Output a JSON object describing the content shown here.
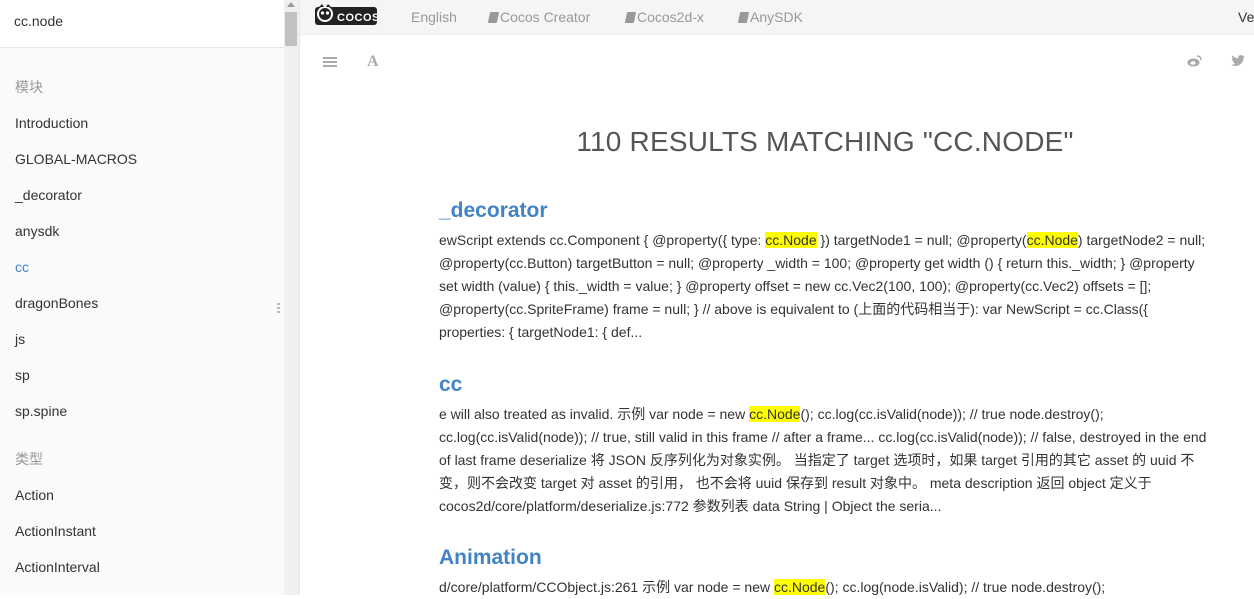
{
  "search": {
    "value": "cc.node"
  },
  "sidebar": {
    "sections": [
      {
        "header": "模块",
        "items": [
          "Introduction",
          "GLOBAL-MACROS",
          "_decorator",
          "anysdk",
          "cc",
          "dragonBones",
          "js",
          "sp",
          "sp.spine"
        ]
      },
      {
        "header": "类型",
        "items": [
          "Action",
          "ActionInstant",
          "ActionInterval"
        ]
      }
    ],
    "active_item": "cc"
  },
  "topbar": {
    "logo_text": "COCOS",
    "links": [
      "English",
      "Cocos Creator",
      "Cocos2d-x",
      "AnySDK"
    ],
    "right_text": "Ve"
  },
  "toolbar": {
    "font_icon_glyph": "A"
  },
  "results": {
    "title": "110 RESULTS MATCHING \"CC.NODE\"",
    "highlight": "cc.Node",
    "items": [
      {
        "title": "_decorator",
        "text": "ewScript extends cc.Component { @property({ type: cc.Node }) targetNode1 = null; @property(cc.Node) targetNode2 = null; @property(cc.Button) targetButton = null; @property _width = 100; @property get width () { return this._width; } @property set width (value) { this._width = value; } @property offset = new cc.Vec2(100, 100); @property(cc.Vec2) offsets = []; @property(cc.SpriteFrame) frame = null; } // above is equivalent to (上面的代码相当于): var NewScript = cc.Class({ properties: { targetNode1: { def..."
      },
      {
        "title": "cc",
        "text": "e will also treated as invalid. 示例 var node = new cc.Node(); cc.log(cc.isValid(node)); // true node.destroy(); cc.log(cc.isValid(node)); // true, still valid in this frame // after a frame... cc.log(cc.isValid(node)); // false, destroyed in the end of last frame deserialize 将 JSON 反序列化为对象实例。 当指定了 target 选项时，如果 target 引用的其它 asset 的 uuid 不变，则不会改变 target 对 asset 的引用， 也不会将 uuid 保存到 result 对象中。 meta description 返回 object 定义于 cocos2d/core/platform/deserialize.js:772 参数列表 data String | Object the seria..."
      },
      {
        "title": "Animation",
        "text": "d/core/platform/CCObject.js:261 示例 var node = new cc.Node(); cc.log(node.isValid); // true node.destroy();"
      }
    ]
  },
  "colors": {
    "link": "#4183c4",
    "highlight": "#ffff00",
    "muted": "#999999"
  }
}
